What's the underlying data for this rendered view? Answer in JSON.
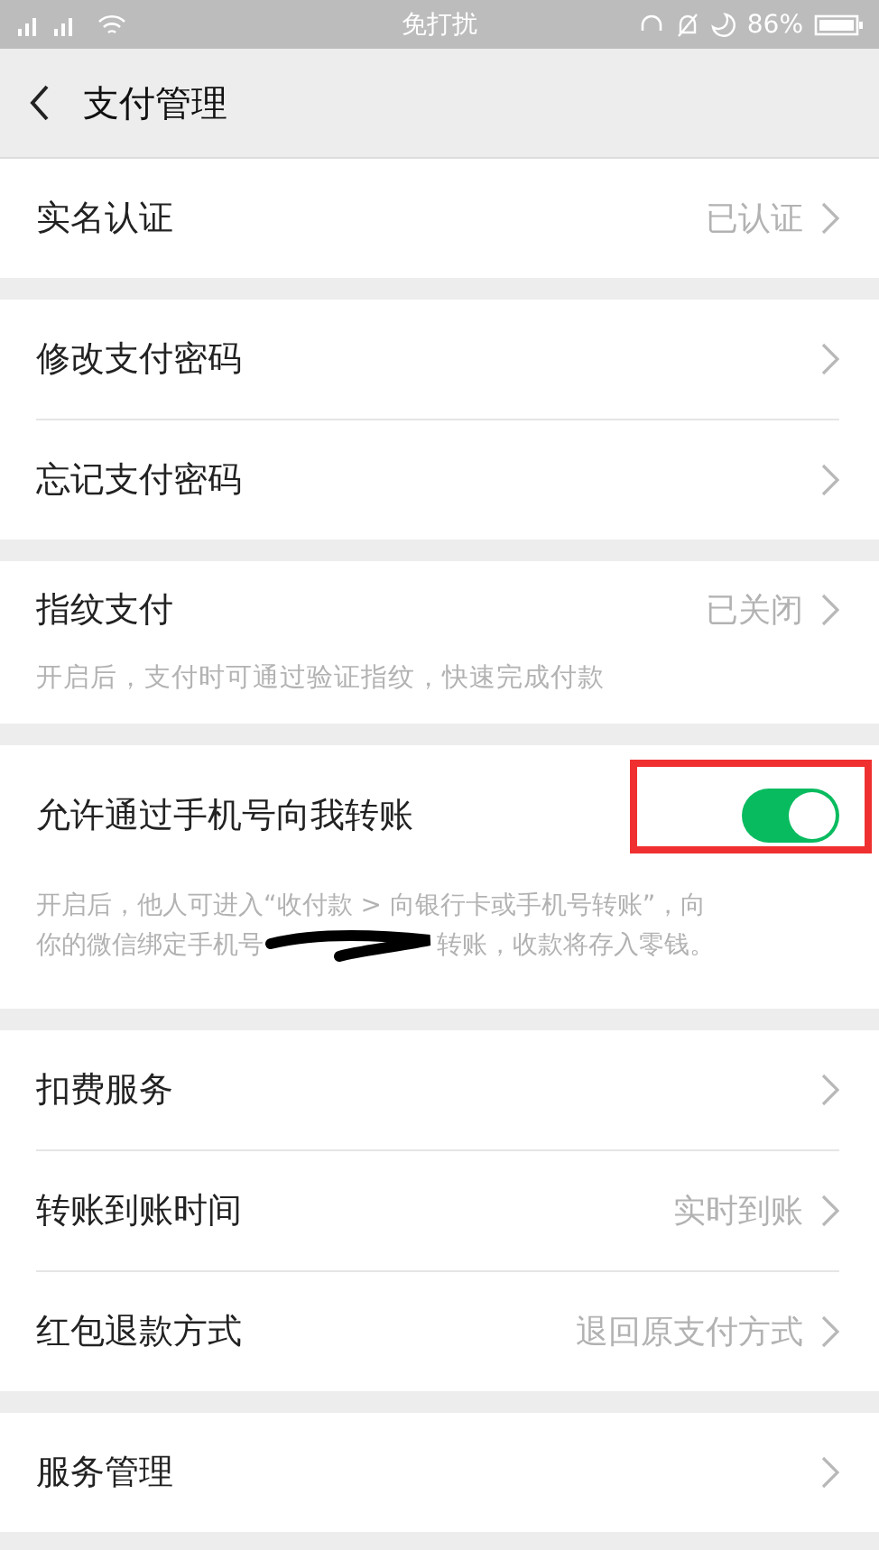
{
  "status_bar": {
    "center": "免打扰",
    "battery": "86%"
  },
  "header": {
    "title": "支付管理"
  },
  "sections": [
    {
      "items": [
        {
          "kind": "link",
          "label": "实名认证",
          "value": "已认证"
        }
      ]
    },
    {
      "items": [
        {
          "kind": "link",
          "label": "修改支付密码"
        },
        {
          "kind": "link",
          "label": "忘记支付密码"
        }
      ]
    },
    {
      "items": [
        {
          "kind": "link",
          "label": "指纹支付",
          "value": "已关闭",
          "description": "开启后，支付时可通过验证指纹，快速完成付款"
        }
      ]
    },
    {
      "items": [
        {
          "kind": "toggle",
          "label": "允许通过手机号向我转账",
          "on": true,
          "highlighted": true,
          "description_lines": [
            "开启后，他人可进入“收付款 > 向银行卡或手机号转账”，向",
            "你的微信绑定手机号",
            "转账，收款将存入零钱。"
          ]
        }
      ]
    },
    {
      "items": [
        {
          "kind": "link",
          "label": "扣费服务"
        },
        {
          "kind": "link",
          "label": "转账到账时间",
          "value": "实时到账"
        },
        {
          "kind": "link",
          "label": "红包退款方式",
          "value": "退回原支付方式"
        }
      ]
    },
    {
      "items": [
        {
          "kind": "link",
          "label": "服务管理"
        }
      ]
    }
  ]
}
